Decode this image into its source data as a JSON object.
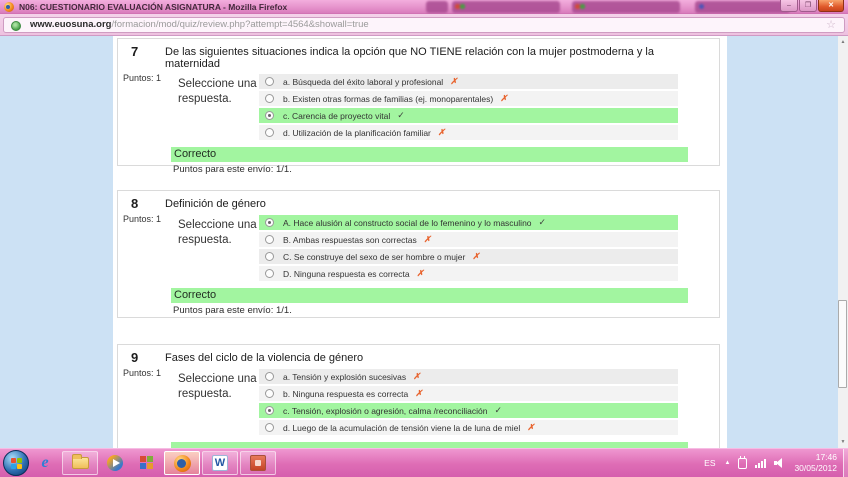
{
  "window": {
    "title": "N06: CUESTIONARIO EVALUACIÓN ASIGNATURA - Mozilla Firefox",
    "controls": {
      "minimize": "–",
      "maximize": "❐",
      "close": "✕"
    }
  },
  "browser": {
    "url_domain": "www.euosuna.org",
    "url_path": "/formacion/mod/quiz/review.php?attempt=4564&showall=true",
    "bookmark_star": "☆"
  },
  "scrollbar": {
    "up_arrow": "▲",
    "down_arrow": "▼"
  },
  "quiz": {
    "questions": [
      {
        "number": "7",
        "points": "Puntos: 1",
        "prompt": "De las siguientes situaciones indica la opción que NO TIENE relación con la mujer postmoderna y la maternidad",
        "select_label": "Seleccione una respuesta.",
        "options": [
          {
            "label": "a. Búsqueda del éxito laboral y profesional",
            "mark": "✗",
            "state": "wrong",
            "selected": false
          },
          {
            "label": "b. Existen otras formas de familias (ej. monoparentales)",
            "mark": "✗",
            "state": "wrong",
            "selected": false
          },
          {
            "label": "c. Carencia de proyecto vital",
            "mark": "✓",
            "state": "correct",
            "selected": true
          },
          {
            "label": "d. Utilización de la planificación familiar",
            "mark": "✗",
            "state": "wrong",
            "selected": false
          }
        ],
        "feedback": "Correcto",
        "score": "Puntos para este envío: 1/1."
      },
      {
        "number": "8",
        "points": "Puntos: 1",
        "prompt": "Definición de género",
        "select_label": "Seleccione una respuesta.",
        "options": [
          {
            "label": "A. Hace alusión al constructo social de lo femenino y lo masculino",
            "mark": "✓",
            "state": "correct",
            "selected": true
          },
          {
            "label": "B. Ambas respuestas son correctas",
            "mark": "✗",
            "state": "wrong",
            "selected": false
          },
          {
            "label": "C. Se construye del sexo de ser hombre o mujer",
            "mark": "✗",
            "state": "wrong",
            "selected": false
          },
          {
            "label": "D. Ninguna respuesta es correcta",
            "mark": "✗",
            "state": "wrong",
            "selected": false
          }
        ],
        "feedback": "Correcto",
        "score": "Puntos para este envío: 1/1."
      },
      {
        "number": "9",
        "points": "Puntos: 1",
        "prompt": "Fases del ciclo de la violencia de género",
        "select_label": "Seleccione una respuesta.",
        "options": [
          {
            "label": "a. Tensión y explosión sucesivas",
            "mark": "✗",
            "state": "wrong",
            "selected": false
          },
          {
            "label": "b. Ninguna respuesta es correcta",
            "mark": "✗",
            "state": "wrong",
            "selected": false
          },
          {
            "label": "c. Tensión, explosión o agresión, calma /reconciliación",
            "mark": "✓",
            "state": "correct",
            "selected": true
          },
          {
            "label": "d. Luego de la acumulación de tensión viene la de luna de miel",
            "mark": "✗",
            "state": "wrong",
            "selected": false
          }
        ],
        "feedback": "",
        "score": ""
      }
    ]
  },
  "taskbar": {
    "language": "ES",
    "hidden_icons_arrow": "▲",
    "time": "17:46",
    "date": "30/05/2012",
    "buttons": [
      "start",
      "internet-explorer",
      "explorer-folder",
      "media-player",
      "desktop-tiles",
      "firefox",
      "word",
      "powerpoint"
    ]
  },
  "colors": {
    "titlebar_pink": "#e98fcb",
    "taskbar_pink": "#de6cb5",
    "content_blue": "#cce1f4",
    "correct_green": "#a2f5a0",
    "row_grey": "#ececec",
    "wrong_mark_orange": "#e8642f",
    "close_button_orange": "#e05a2b"
  }
}
